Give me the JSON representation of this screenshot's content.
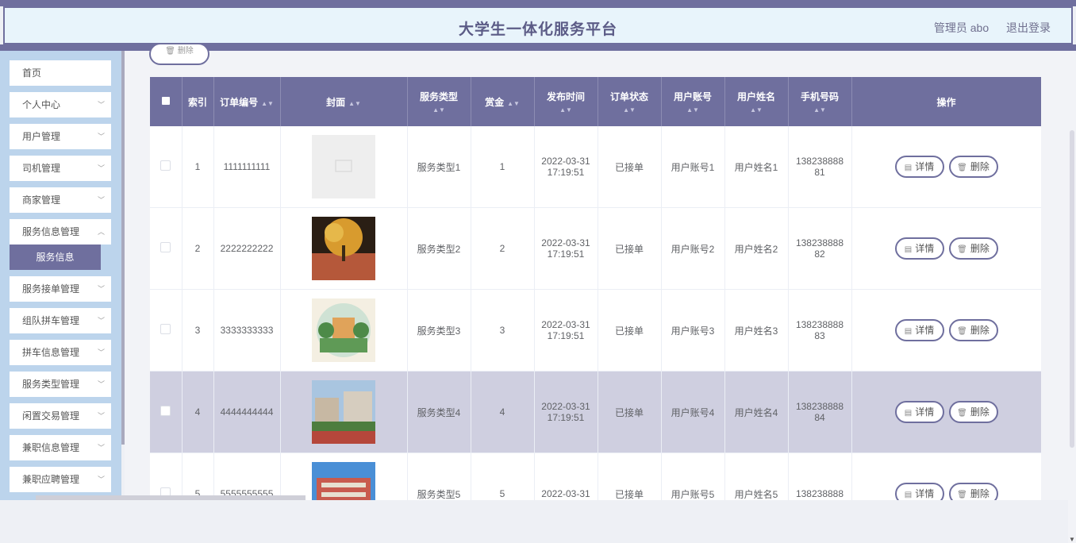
{
  "header": {
    "title": "大学生一体化服务平台",
    "user": "管理员 abo",
    "logout": "退出登录"
  },
  "sidebar": {
    "items": [
      {
        "label": "首页"
      },
      {
        "label": "个人中心"
      },
      {
        "label": "用户管理"
      },
      {
        "label": "司机管理"
      },
      {
        "label": "商家管理"
      },
      {
        "label": "服务信息管理"
      },
      {
        "label": "服务接单管理"
      },
      {
        "label": "组队拼车管理"
      },
      {
        "label": "拼车信息管理"
      },
      {
        "label": "服务类型管理"
      },
      {
        "label": "闲置交易管理"
      },
      {
        "label": "兼职信息管理"
      },
      {
        "label": "兼职应聘管理"
      }
    ],
    "sub_item": "服务信息"
  },
  "toolbar": {
    "delete_label": "删除"
  },
  "table": {
    "headers": {
      "index": "索引",
      "order_no": "订单编号",
      "cover": "封面",
      "service_type": "服务类型",
      "reward": "赏金",
      "publish_time": "发布时间",
      "order_status": "订单状态",
      "user_account": "用户账号",
      "user_name": "用户姓名",
      "phone": "手机号码",
      "actions": "操作"
    },
    "rows": [
      {
        "index": "1",
        "order_no": "1111111111",
        "service_type": "服务类型1",
        "reward": "1",
        "date": "2022-03-31",
        "time": "17:19:51",
        "status": "已接单",
        "account": "用户账号1",
        "name": "用户姓名1",
        "phone_a": "138238888",
        "phone_b": "81"
      },
      {
        "index": "2",
        "order_no": "2222222222",
        "service_type": "服务类型2",
        "reward": "2",
        "date": "2022-03-31",
        "time": "17:19:51",
        "status": "已接单",
        "account": "用户账号2",
        "name": "用户姓名2",
        "phone_a": "138238888",
        "phone_b": "82"
      },
      {
        "index": "3",
        "order_no": "3333333333",
        "service_type": "服务类型3",
        "reward": "3",
        "date": "2022-03-31",
        "time": "17:19:51",
        "status": "已接单",
        "account": "用户账号3",
        "name": "用户姓名3",
        "phone_a": "138238888",
        "phone_b": "83"
      },
      {
        "index": "4",
        "order_no": "4444444444",
        "service_type": "服务类型4",
        "reward": "4",
        "date": "2022-03-31",
        "time": "17:19:51",
        "status": "已接单",
        "account": "用户账号4",
        "name": "用户姓名4",
        "phone_a": "138238888",
        "phone_b": "84"
      },
      {
        "index": "5",
        "order_no": "5555555555",
        "service_type": "服务类型5",
        "reward": "5",
        "date": "2022-03-31",
        "time": "",
        "status": "已接单",
        "account": "用户账号5",
        "name": "用户姓名5",
        "phone_a": "138238888",
        "phone_b": ""
      }
    ],
    "detail_label": "详情",
    "delete_label": "删除"
  },
  "colors": {
    "accent": "#6f6f9e",
    "sidebar_bg": "#bcd4ec",
    "header_bg": "#e8f4fb",
    "highlight_row": "#cfcfe0"
  }
}
